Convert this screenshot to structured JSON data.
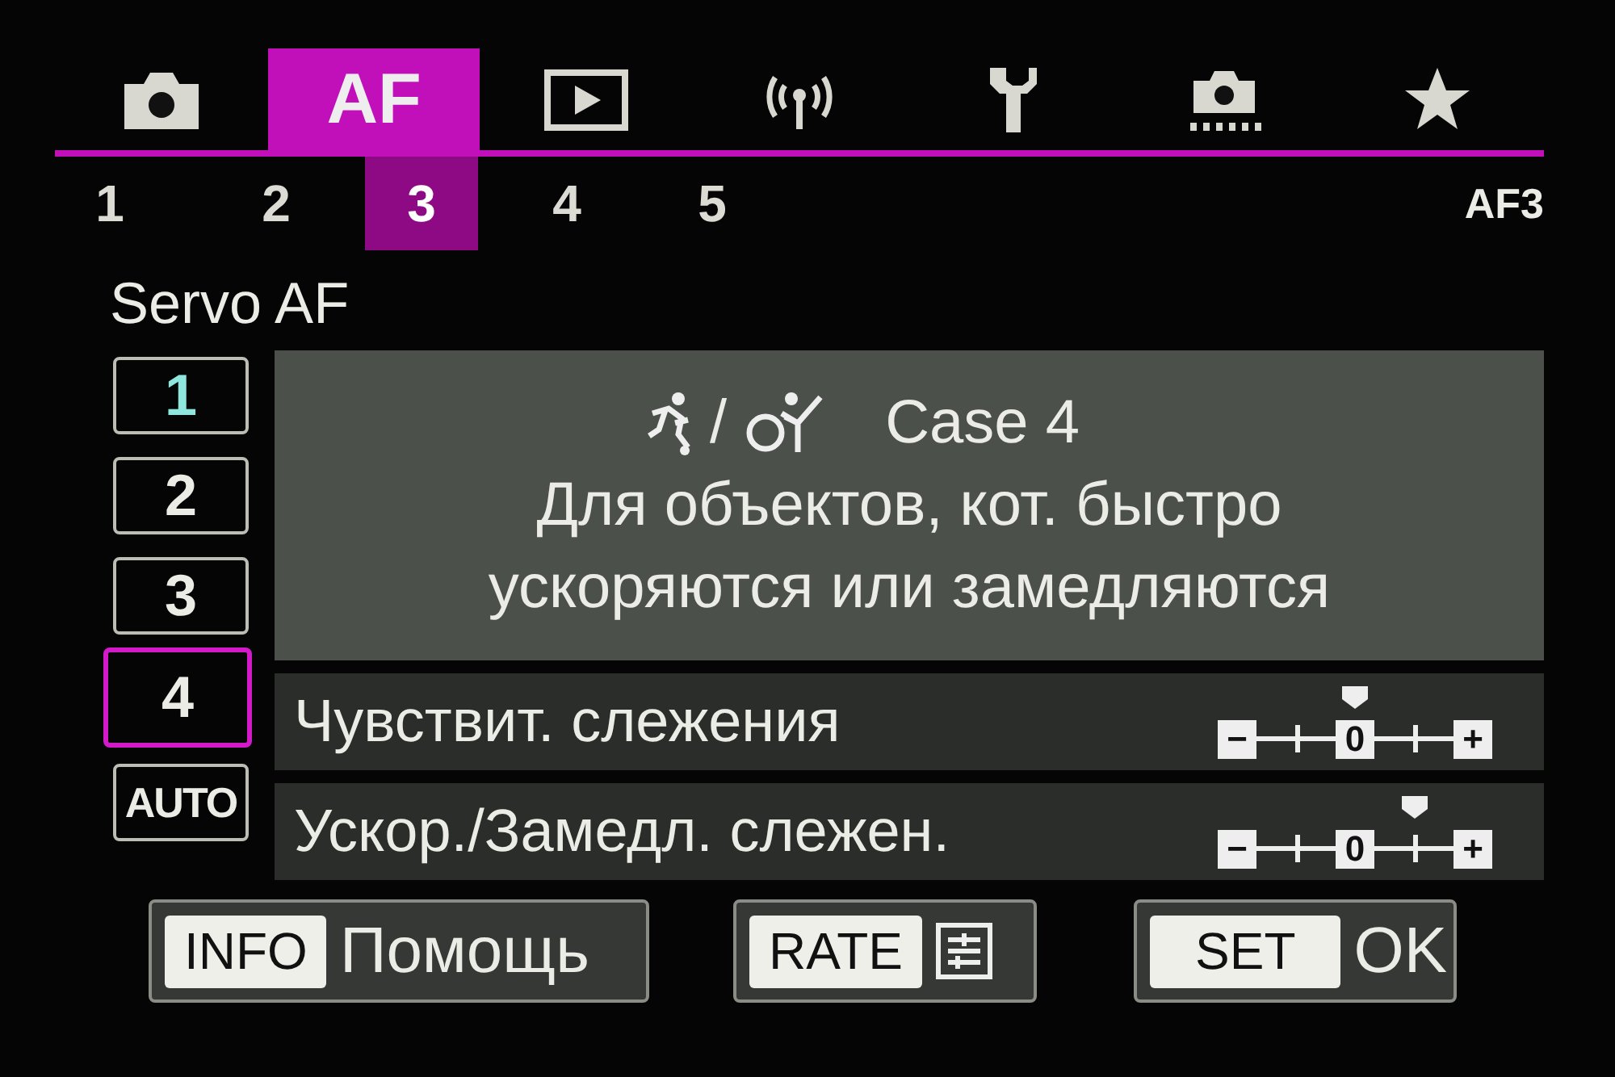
{
  "tabs": [
    {
      "kind": "camera",
      "selected": false
    },
    {
      "kind": "text",
      "label": "AF",
      "selected": true
    },
    {
      "kind": "play",
      "selected": false
    },
    {
      "kind": "wireless",
      "selected": false
    },
    {
      "kind": "wrench",
      "selected": false
    },
    {
      "kind": "camera-dots",
      "selected": false
    },
    {
      "kind": "star",
      "selected": false
    }
  ],
  "subtabs": [
    {
      "label": "1",
      "selected": false
    },
    {
      "label": "2",
      "selected": false
    },
    {
      "label": "3",
      "selected": true
    },
    {
      "label": "4",
      "selected": false
    },
    {
      "label": "5",
      "selected": false
    }
  ],
  "page_code": "AF3",
  "title": "Servo AF",
  "cases": [
    {
      "label": "1",
      "selected": false,
      "current": true
    },
    {
      "label": "2",
      "selected": false,
      "current": false
    },
    {
      "label": "3",
      "selected": false,
      "current": false
    },
    {
      "label": "4",
      "selected": true,
      "current": false
    },
    {
      "label": "AUTO",
      "selected": false,
      "current": false
    }
  ],
  "case_panel": {
    "separator": "/",
    "title": "Case 4",
    "description": [
      "Для объектов, кот. быстро",
      "ускоряются или замедляются"
    ]
  },
  "settings": [
    {
      "label": "Чувствит. слежения",
      "level": 0.5,
      "scale": [
        "−",
        "0",
        "+"
      ]
    },
    {
      "label": "Ускор./Замедл. слежен.",
      "level": 0.75,
      "scale": [
        "−",
        "0",
        "+"
      ]
    }
  ],
  "buttons": [
    {
      "kind": "text",
      "key": "INFO",
      "label": "Помощь"
    },
    {
      "kind": "icon",
      "key": "RATE"
    },
    {
      "kind": "text",
      "key": "SET",
      "label": "OK"
    }
  ]
}
